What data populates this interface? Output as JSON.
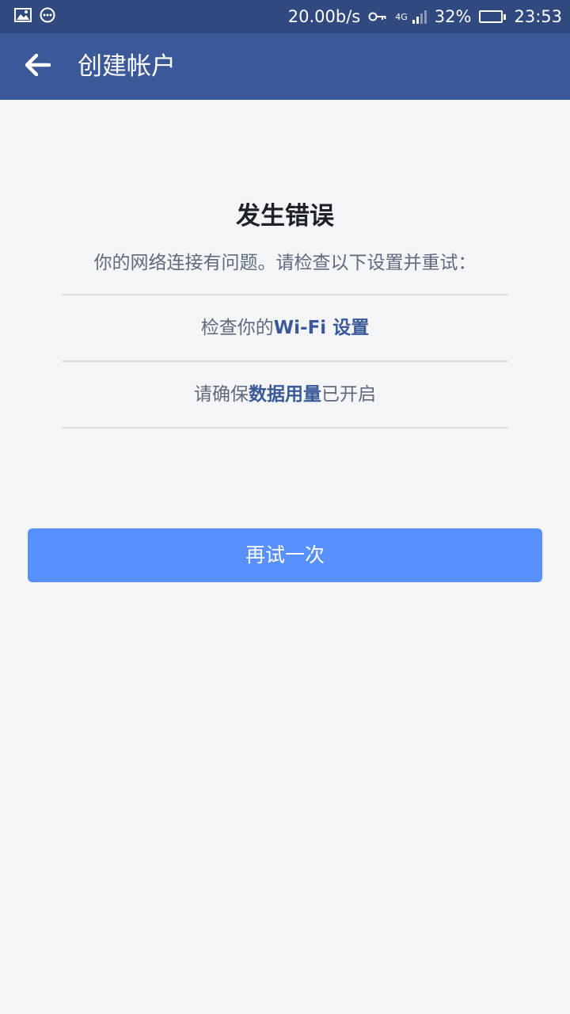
{
  "status_bar": {
    "network_speed": "20.00b/s",
    "network_type": "4G",
    "battery_percent": "32%",
    "battery_level": 0.32,
    "time": "23:53",
    "icons": [
      "image-icon",
      "message-icon",
      "vpn-key-icon",
      "signal-icon",
      "battery-icon"
    ]
  },
  "app_bar": {
    "title": "创建帐户",
    "back_icon": "arrow-left-icon"
  },
  "error": {
    "title": "发生错误",
    "message": "你的网络连接有问题。请检查以下设置并重试："
  },
  "checks": {
    "wifi": {
      "prefix": "检查你的",
      "link": "Wi-Fi 设置",
      "suffix": ""
    },
    "data": {
      "prefix": "请确保",
      "link": "数据用量",
      "suffix": "已开启"
    }
  },
  "retry_button": {
    "label": "再试一次"
  },
  "colors": {
    "status_bar": "#30497e",
    "app_bar": "#3b5998",
    "background": "#f4f5f6",
    "link": "#3b5998",
    "button": "#5890ff",
    "battery_fill": "#2ee82e"
  }
}
